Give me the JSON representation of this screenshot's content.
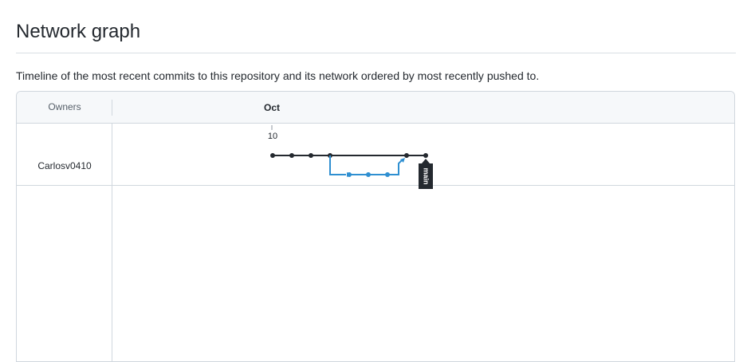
{
  "page": {
    "title": "Network graph",
    "description": "Timeline of the most recent commits to this repository and its network ordered by most recently pushed to."
  },
  "graph": {
    "owners_header": "Owners",
    "month_label": "Oct",
    "day_label": "10",
    "owners": [
      {
        "name": "Carlosv0410"
      }
    ],
    "branch_tag": "main",
    "colors": {
      "main_branch": "#24292f",
      "feature_branch": "#2f8fd1",
      "tag_background": "#24292f"
    },
    "main_commit_count": 6,
    "feature_commit_count": 3
  }
}
